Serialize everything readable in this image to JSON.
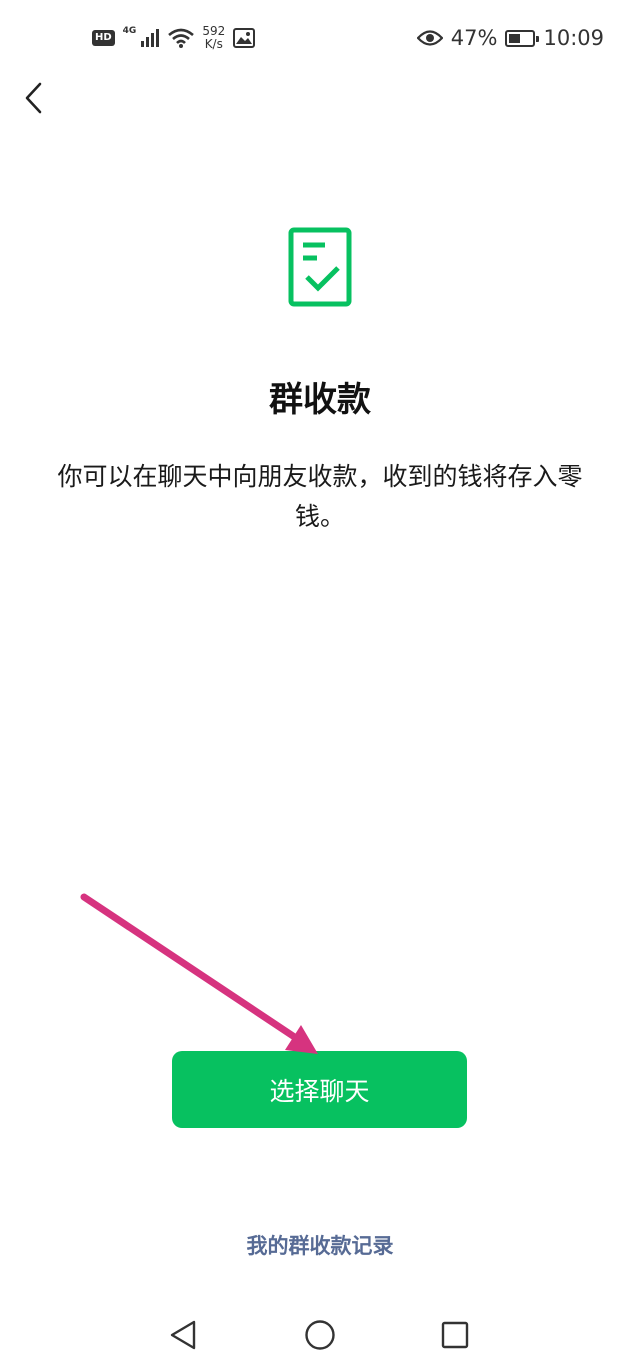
{
  "status_bar": {
    "hd": "HD",
    "network_type": "4G",
    "speed_value": "592",
    "speed_unit": "K/s",
    "battery_percent": "47%",
    "battery_level": 0.47,
    "time": "10:09",
    "icons": [
      "signal-icon",
      "wifi-icon",
      "gallery-icon",
      "eye-icon",
      "battery-icon"
    ]
  },
  "header": {
    "back_icon": "chevron-left-icon"
  },
  "main": {
    "icon": "document-check-icon",
    "title": "群收款",
    "description": "你可以在聊天中向朋友收款，收到的钱将存入零钱。",
    "primary_button": "选择聊天",
    "records_link": "我的群收款记录"
  },
  "colors": {
    "accent": "#07c160",
    "link": "#576b95",
    "annotation_arrow": "#d6337f"
  },
  "nav_bar": {
    "icons": [
      "nav-back-icon",
      "nav-home-icon",
      "nav-recents-icon"
    ]
  }
}
